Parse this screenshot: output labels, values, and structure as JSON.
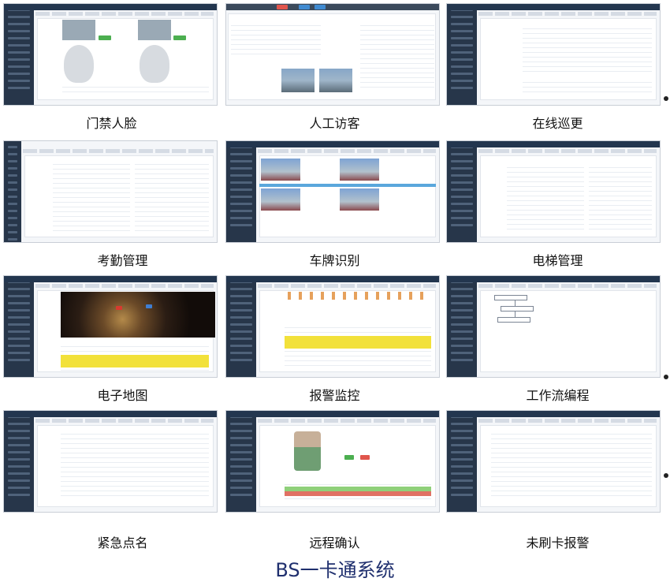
{
  "grid": {
    "rows": [
      [
        {
          "id": "face-access",
          "label": "门禁人脸"
        },
        {
          "id": "manual-visitor",
          "label": "人工访客"
        },
        {
          "id": "online-patrol",
          "label": "在线巡更"
        }
      ],
      [
        {
          "id": "attendance",
          "label": "考勤管理"
        },
        {
          "id": "plate-recognition",
          "label": "车牌识别"
        },
        {
          "id": "elevator",
          "label": "电梯管理"
        }
      ],
      [
        {
          "id": "electronic-map",
          "label": "电子地图"
        },
        {
          "id": "alarm-monitor",
          "label": "报警监控"
        },
        {
          "id": "workflow",
          "label": "工作流编程"
        }
      ],
      [
        {
          "id": "emergency-rollcall",
          "label": "紧急点名"
        },
        {
          "id": "remote-confirm",
          "label": "远程确认"
        },
        {
          "id": "no-card-alarm",
          "label": "未刷卡报警"
        }
      ]
    ]
  },
  "footer_title": "BS一卡通系统",
  "colors": {
    "sidebar": "#27364a",
    "highlight": "#f2e13a",
    "title": "#1f2f6e"
  }
}
